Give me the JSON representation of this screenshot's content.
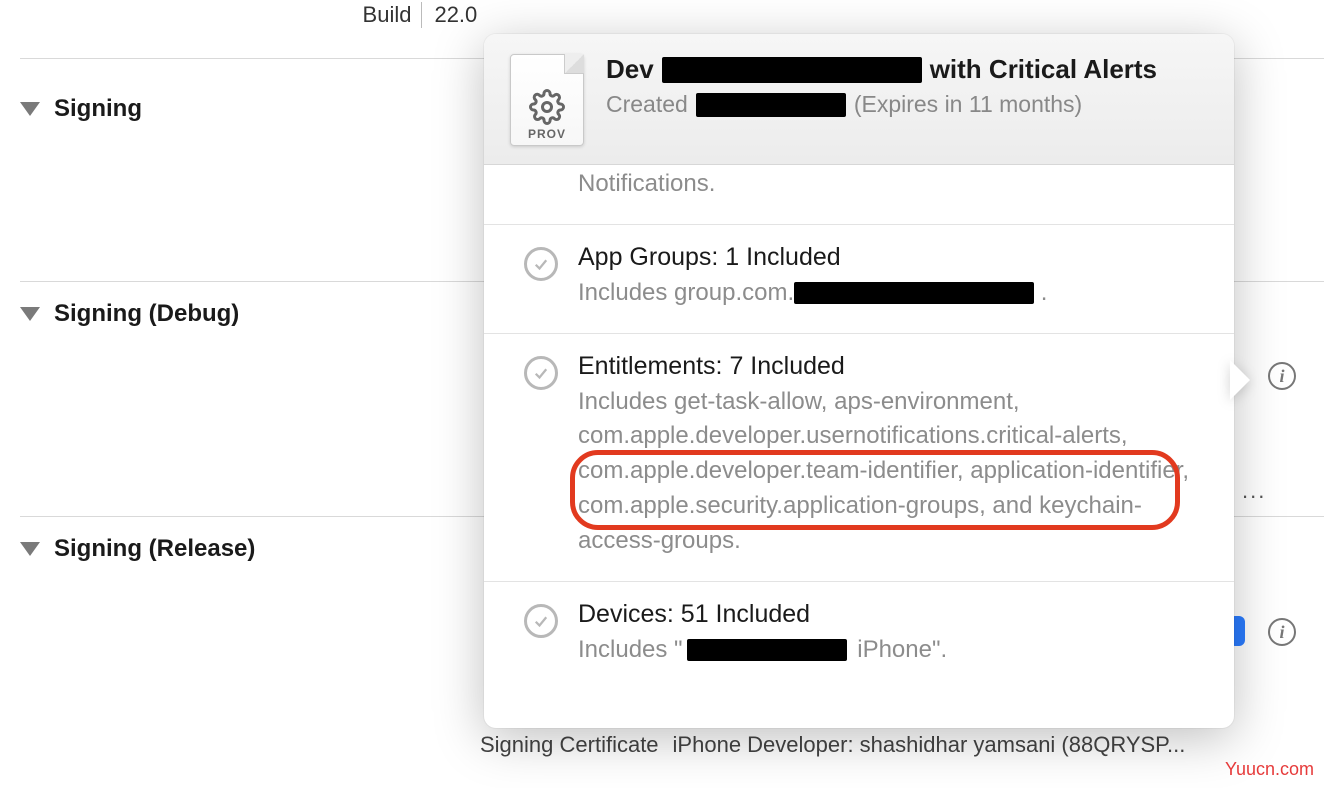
{
  "build": {
    "label": "Build",
    "value": "22.0"
  },
  "sections": {
    "signing": "Signing",
    "signing_debug": "Signing (Debug)",
    "signing_release": "Signing (Release)"
  },
  "signing_cert": {
    "label": "Signing Certificate",
    "value": "iPhone Developer: shashidhar yamsani (88QRYSP..."
  },
  "popover": {
    "title_prefix": "Dev ",
    "title_suffix": " with Critical Alerts",
    "created_label": "Created ",
    "expires": " (Expires in 11 months)",
    "prov_label": "PROV",
    "items": {
      "notifications_tail": "Notifications.",
      "app_groups": {
        "title": "App Groups: 1 Included",
        "detail_prefix": "Includes group.com.",
        "detail_suffix": " ."
      },
      "entitlements": {
        "title": "Entitlements: 7 Included",
        "detail": "Includes get-task-allow, aps-environment, com.apple.developer.usernotifications.critical-alerts, com.apple.developer.team-identifier, application-identifier, com.apple.security.application-groups, and keychain-access-groups."
      },
      "devices": {
        "title": "Devices: 51 Included",
        "detail_prefix": "Includes \"",
        "detail_suffix": " iPhone\"."
      }
    }
  },
  "watermark": "Yuucn.com"
}
